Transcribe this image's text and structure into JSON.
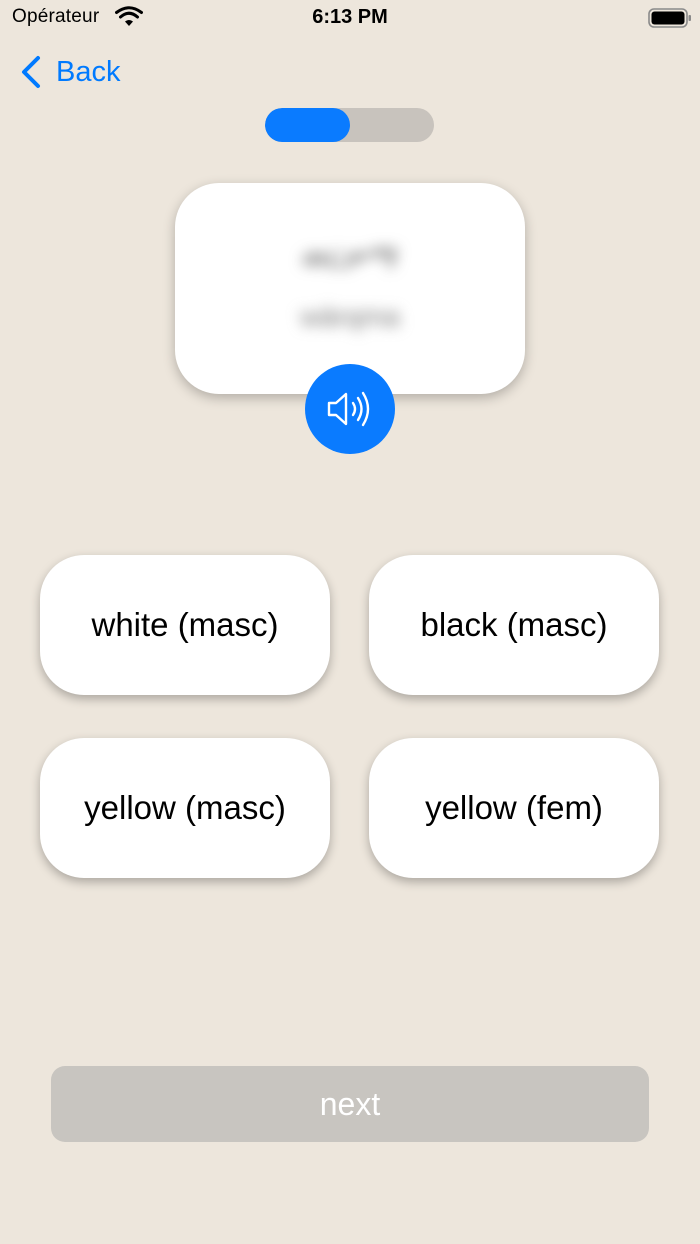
{
  "status_bar": {
    "carrier": "Opérateur",
    "time": "6:13 PM"
  },
  "nav": {
    "back_label": "Back"
  },
  "progress": {
    "fraction": 0.5
  },
  "prompt": {
    "word": "ወርቃማ",
    "transliteration": "wärqma"
  },
  "choices": [
    "white (masc)",
    "black (masc)",
    "yellow (masc)",
    "yellow (fem)"
  ],
  "next_label": "next",
  "colors": {
    "background": "#ede6dc",
    "accent": "#0a7bff",
    "progress_track": "#c8c3bd",
    "disabled_button": "#c8c5c0"
  }
}
